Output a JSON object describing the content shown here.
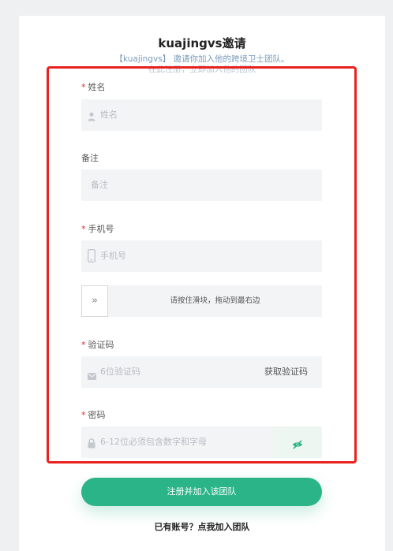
{
  "page": {
    "title": "kuajingvs邀请",
    "subtitle": "【kuajingvs】 邀请你加入他的跨境卫士团队。",
    "subtitle2": "在此注册，立即加入他的团队"
  },
  "form": {
    "required_mark": "*",
    "name": {
      "label": "姓名",
      "placeholder": "姓名",
      "required": true,
      "icon": "user-icon"
    },
    "remark": {
      "label": "备注",
      "placeholder": "备注",
      "required": false
    },
    "phone": {
      "label": "手机号",
      "placeholder": "手机号",
      "required": true,
      "icon": "phone-icon"
    },
    "slider": {
      "handle": "»",
      "text": "请按住滑块，拖动到最右边"
    },
    "code": {
      "label": "验证码",
      "placeholder": "6位验证码",
      "required": true,
      "icon": "mail-icon",
      "action": "获取验证码"
    },
    "password": {
      "label": "密码",
      "placeholder": "6-12位必须包含数字和字母",
      "required": true,
      "icon": "lock-icon",
      "toggle_icon": "eye-off-icon"
    },
    "submit": "注册并加入该团队",
    "login_link": "已有账号？点我加入团队"
  },
  "colors": {
    "accent": "#2bb487",
    "highlight_outline": "#e8231f",
    "required": "#e8231f"
  }
}
